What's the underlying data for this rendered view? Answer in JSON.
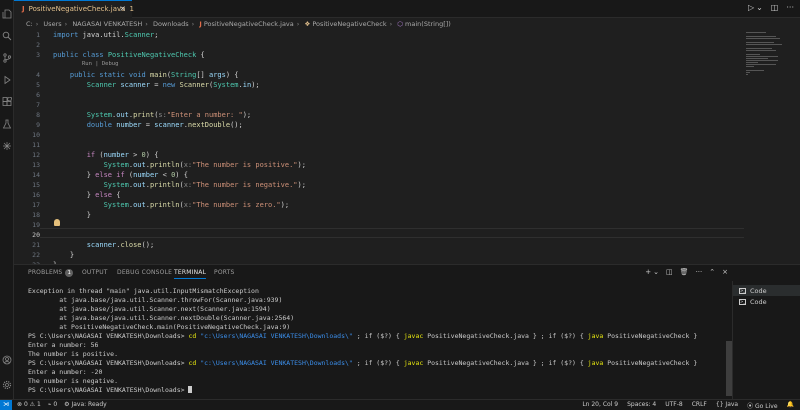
{
  "tab": {
    "lang": "J",
    "filename": "PositiveNegativeCheck.java",
    "modified": "1"
  },
  "breadcrumb": [
    "C:",
    "Users",
    "NAGASAI VENKATESH",
    "Downloads",
    "PositiveNegativeCheck.java",
    "PositiveNegativeCheck",
    "main(String[])"
  ],
  "codelens": "Run | Debug",
  "editor_lines": [
    {
      "n": "1",
      "html": "<span class=\"k\">import</span> <span class=\"p\">java.util.</span><span class=\"t\">Scanner</span><span class=\"p\">;</span>"
    },
    {
      "n": "2",
      "html": ""
    },
    {
      "n": "3",
      "html": "<span class=\"k\">public</span> <span class=\"k\">class</span> <span class=\"t\">PositiveNegativeCheck</span> <span class=\"p\">{</span>"
    },
    {
      "n": "4",
      "html": "    <span class=\"k\">public</span> <span class=\"k\">static</span> <span class=\"k\">void</span> <span class=\"f\">main</span><span class=\"p\">(</span><span class=\"t\">String</span><span class=\"p\">[]</span> <span class=\"v\">args</span><span class=\"p\">) {</span>"
    },
    {
      "n": "5",
      "html": "        <span class=\"t\">Scanner</span> <span class=\"v\">scanner</span> <span class=\"p\">=</span> <span class=\"k\">new</span> <span class=\"f\">Scanner</span><span class=\"p\">(</span><span class=\"t\">System</span><span class=\"p\">.</span><span class=\"v\">in</span><span class=\"p\">);</span>"
    },
    {
      "n": "6",
      "html": ""
    },
    {
      "n": "7",
      "html": ""
    },
    {
      "n": "8",
      "html": "        <span class=\"t\">System</span><span class=\"p\">.</span><span class=\"v\">out</span><span class=\"p\">.</span><span class=\"f\">print</span><span class=\"p\">(</span><span class=\"hint\">s:</span><span class=\"s\">\"Enter a number: \"</span><span class=\"p\">);</span>"
    },
    {
      "n": "9",
      "html": "        <span class=\"k\">double</span> <span class=\"v\">number</span> <span class=\"p\">=</span> <span class=\"v\">scanner</span><span class=\"p\">.</span><span class=\"f\">nextDouble</span><span class=\"p\">();</span>"
    },
    {
      "n": "10",
      "html": ""
    },
    {
      "n": "11",
      "html": ""
    },
    {
      "n": "12",
      "html": "        <span class=\"kp\">if</span> <span class=\"p\">(</span><span class=\"v\">number</span> <span class=\"p\">&gt;</span> <span class=\"n\">0</span><span class=\"p\">) {</span>"
    },
    {
      "n": "13",
      "html": "            <span class=\"t\">System</span><span class=\"p\">.</span><span class=\"v\">out</span><span class=\"p\">.</span><span class=\"f\">println</span><span class=\"p\">(</span><span class=\"hint\">x:</span><span class=\"s\">\"The number is positive.\"</span><span class=\"p\">);</span>"
    },
    {
      "n": "14",
      "html": "        <span class=\"p\">}</span> <span class=\"kp\">else if</span> <span class=\"p\">(</span><span class=\"v\">number</span> <span class=\"p\">&lt;</span> <span class=\"n\">0</span><span class=\"p\">) {</span>"
    },
    {
      "n": "15",
      "html": "            <span class=\"t\">System</span><span class=\"p\">.</span><span class=\"v\">out</span><span class=\"p\">.</span><span class=\"f\">println</span><span class=\"p\">(</span><span class=\"hint\">x:</span><span class=\"s\">\"The number is negative.\"</span><span class=\"p\">);</span>"
    },
    {
      "n": "16",
      "html": "        <span class=\"p\">}</span> <span class=\"kp\">else</span> <span class=\"p\">{</span>"
    },
    {
      "n": "17",
      "html": "            <span class=\"t\">System</span><span class=\"p\">.</span><span class=\"v\">out</span><span class=\"p\">.</span><span class=\"f\">println</span><span class=\"p\">(</span><span class=\"hint\">x:</span><span class=\"s\">\"The number is zero.\"</span><span class=\"p\">);</span>"
    },
    {
      "n": "18",
      "html": "        <span class=\"p\">}</span>"
    },
    {
      "n": "19",
      "html": ""
    },
    {
      "n": "20",
      "html": ""
    },
    {
      "n": "21",
      "html": "        <span class=\"v\">scanner</span><span class=\"p\">.</span><span class=\"f\">close</span><span class=\"p\">();</span>"
    },
    {
      "n": "22",
      "html": "    <span class=\"p\">}</span>"
    },
    {
      "n": "23",
      "html": "<span class=\"p\">}</span>"
    }
  ],
  "panel": {
    "tabs": [
      "PROBLEMS",
      "OUTPUT",
      "DEBUG CONSOLE",
      "TERMINAL",
      "PORTS"
    ],
    "problems_count": "1",
    "active_tab": "TERMINAL"
  },
  "terminal_lines": [
    "Exception in thread \"main\" java.util.InputMismatchException",
    "        at java.base/java.util.Scanner.throwFor(Scanner.java:939)",
    "        at java.base/java.util.Scanner.next(Scanner.java:1594)",
    "        at java.base/java.util.Scanner.nextDouble(Scanner.java:2564)",
    "        at PositiveNegativeCheck.main(PositiveNegativeCheck.java:9)",
    "@CMD",
    "Enter a number: 56",
    "The number is positive.",
    "@CMD",
    "Enter a number: -20",
    "The number is negative.",
    "@PROMPT"
  ],
  "prompt": "PS C:\\Users\\NAGASAI VENKATESH\\Downloads>",
  "command": {
    "cd": "cd",
    "path": "\"c:\\Users\\NAGASAI VENKATESH\\Downloads\\\"",
    "rest1": " ; if ($?) { ",
    "javac": "javac",
    "file": " PositiveNegativeCheck.java } ; if ($?) { ",
    "java": "java",
    "cls": " PositiveNegativeCheck }"
  },
  "terminal_list": [
    "Code",
    "Code"
  ],
  "status": {
    "errors": "0",
    "warnings": "1",
    "ports": "0",
    "java": "Java: Ready",
    "position": "Ln 20, Col 9",
    "spaces": "Spaces: 4",
    "encoding": "UTF-8",
    "eol": "CRLF",
    "language": "{} Java",
    "golive": "Go Live"
  }
}
